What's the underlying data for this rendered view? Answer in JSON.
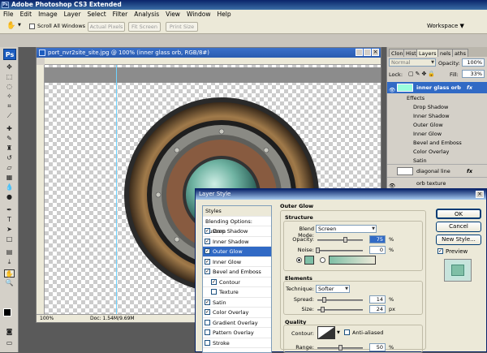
{
  "app": {
    "title": "Adobe Photoshop CS3 Extended",
    "logo": "Ps",
    "logo_color": "#1c5dbf"
  },
  "menu": [
    "File",
    "Edit",
    "Image",
    "Layer",
    "Select",
    "Filter",
    "Analysis",
    "View",
    "Window",
    "Help"
  ],
  "options_bar": {
    "scroll_all": "Scroll All Windows",
    "buttons": [
      "Actual Pixels",
      "Fit Screen",
      "Print Size"
    ],
    "workspace": "Workspace"
  },
  "document": {
    "title": "port_nvr2site_site.jpg @ 100% (inner glass orb, RGB/8#)",
    "zoom": "100%",
    "doc_size": "Doc: 1.54M/9.69M"
  },
  "layers_panel": {
    "tabs": [
      "Clon",
      "Hist",
      "Layers",
      "nels",
      "aths"
    ],
    "blend_mode": "Normal",
    "opacity_label": "Opacity:",
    "opacity": "100%",
    "lock_label": "Lock:",
    "fill_label": "Fill:",
    "fill": "33%",
    "active_layer": "inner glass orb",
    "effects_label": "Effects",
    "effects": [
      "Drop Shadow",
      "Inner Shadow",
      "Outer Glow",
      "Inner Glow",
      "Bevel and Emboss",
      "Color Overlay",
      "Satin"
    ],
    "other_layers": [
      "diagonal line",
      "orb texture"
    ],
    "fx": "fx"
  },
  "layer_style": {
    "title": "Layer Style",
    "list_head": "Styles",
    "blending": "Blending Options: Custom",
    "styles": [
      {
        "label": "Drop Shadow",
        "checked": true
      },
      {
        "label": "Inner Shadow",
        "checked": true
      },
      {
        "label": "Outer Glow",
        "checked": true,
        "selected": true
      },
      {
        "label": "Inner Glow",
        "checked": true
      },
      {
        "label": "Bevel and Emboss",
        "checked": true
      },
      {
        "label": "Contour",
        "checked": true,
        "indent": true
      },
      {
        "label": "Texture",
        "checked": false,
        "indent": true
      },
      {
        "label": "Satin",
        "checked": true
      },
      {
        "label": "Color Overlay",
        "checked": true
      },
      {
        "label": "Gradient Overlay",
        "checked": false
      },
      {
        "label": "Pattern Overlay",
        "checked": false
      },
      {
        "label": "Stroke",
        "checked": false
      }
    ],
    "outer_glow": {
      "heading": "Outer Glow",
      "structure": "Structure",
      "blend_mode_label": "Blend Mode:",
      "blend_mode": "Screen",
      "opacity_label": "Opacity:",
      "opacity": "75",
      "noise_label": "Noise:",
      "noise": "0",
      "glow_color": "#7fbfa6",
      "elements": "Elements",
      "technique_label": "Technique:",
      "technique": "Softer",
      "spread_label": "Spread:",
      "spread": "14",
      "size_label": "Size:",
      "size": "24",
      "quality": "Quality",
      "contour_label": "Contour:",
      "antialiased": "Anti-aliased",
      "range_label": "Range:",
      "range": "50",
      "pct": "%",
      "px": "px"
    },
    "buttons": {
      "ok": "OK",
      "cancel": "Cancel",
      "new_style": "New Style...",
      "preview": "Preview"
    }
  }
}
